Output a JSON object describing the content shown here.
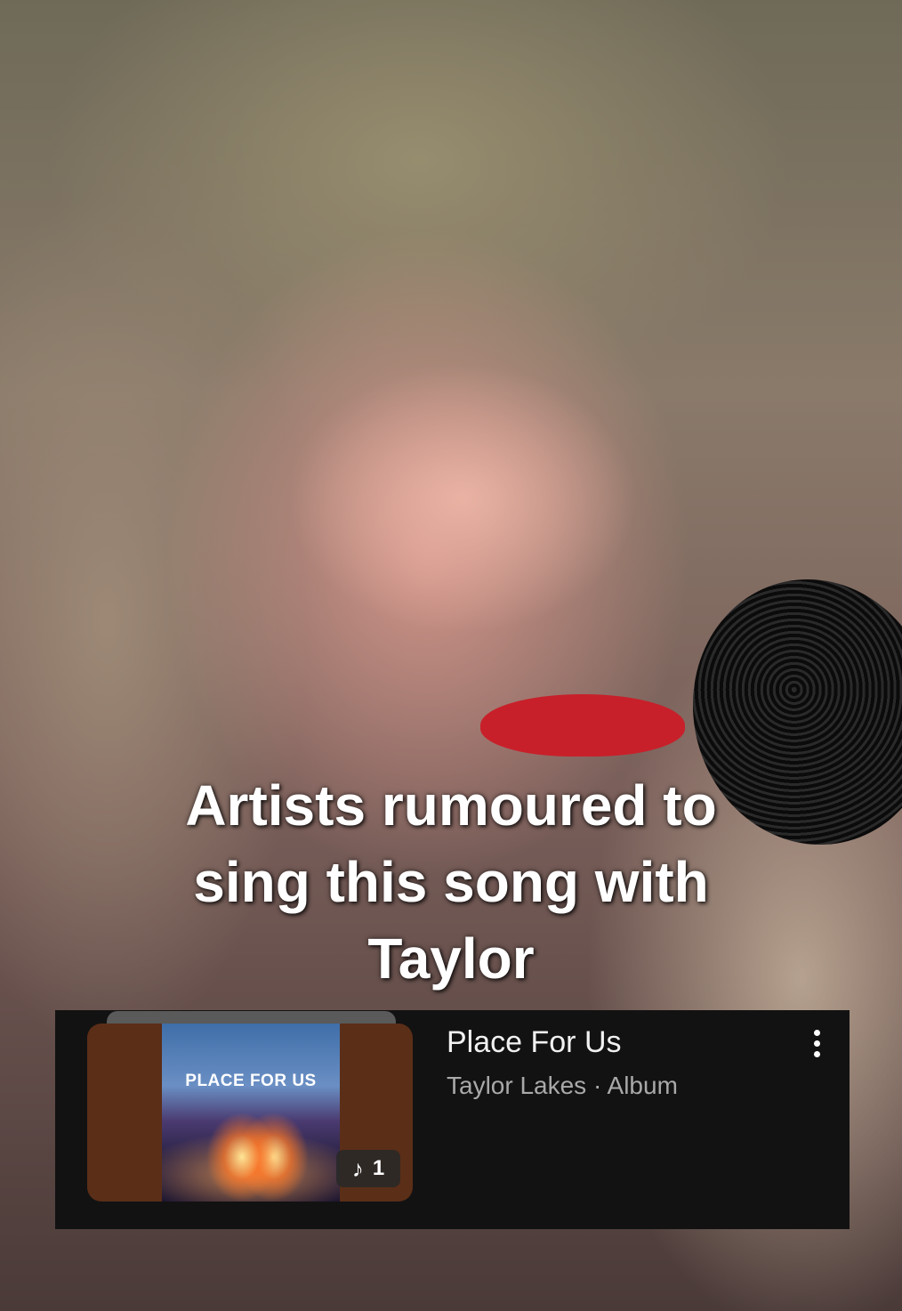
{
  "caption": {
    "lines": [
      "Artists rumoured to",
      "sing this song with",
      "Taylor"
    ]
  },
  "music_card": {
    "album_art_text": "PLACE FOR US",
    "track_count": "1",
    "note_icon": "music-note-icon",
    "title": "Place For Us",
    "subtitle": "Taylor Lakes · Album",
    "more_icon": "more-vertical-icon"
  }
}
